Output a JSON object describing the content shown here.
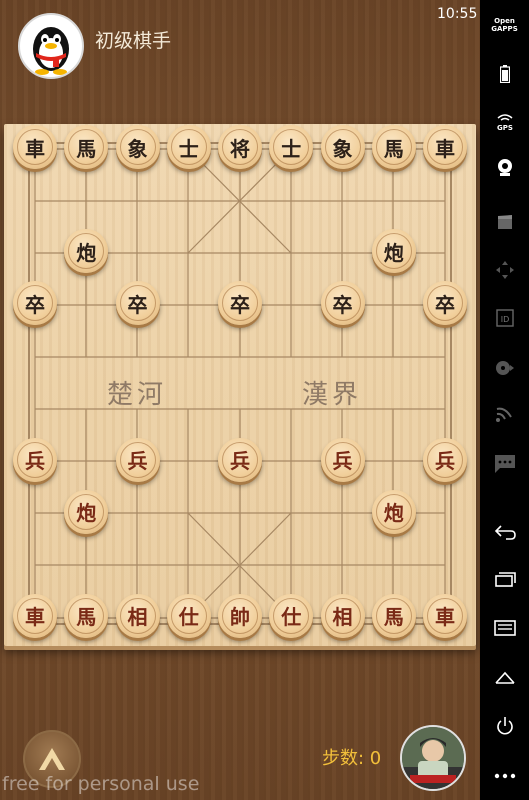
{
  "status": {
    "time": "10:55"
  },
  "header": {
    "title": "初级棋手"
  },
  "board": {
    "river_left": "楚河",
    "river_right": "漢界",
    "black_pieces": [
      {
        "ch": "車",
        "c": 0,
        "r": 0
      },
      {
        "ch": "馬",
        "c": 1,
        "r": 0
      },
      {
        "ch": "象",
        "c": 2,
        "r": 0
      },
      {
        "ch": "士",
        "c": 3,
        "r": 0
      },
      {
        "ch": "将",
        "c": 4,
        "r": 0
      },
      {
        "ch": "士",
        "c": 5,
        "r": 0
      },
      {
        "ch": "象",
        "c": 6,
        "r": 0
      },
      {
        "ch": "馬",
        "c": 7,
        "r": 0
      },
      {
        "ch": "車",
        "c": 8,
        "r": 0
      },
      {
        "ch": "炮",
        "c": 1,
        "r": 2
      },
      {
        "ch": "炮",
        "c": 7,
        "r": 2
      },
      {
        "ch": "卒",
        "c": 0,
        "r": 3
      },
      {
        "ch": "卒",
        "c": 2,
        "r": 3
      },
      {
        "ch": "卒",
        "c": 4,
        "r": 3
      },
      {
        "ch": "卒",
        "c": 6,
        "r": 3
      },
      {
        "ch": "卒",
        "c": 8,
        "r": 3
      }
    ],
    "red_pieces": [
      {
        "ch": "兵",
        "c": 0,
        "r": 6
      },
      {
        "ch": "兵",
        "c": 2,
        "r": 6
      },
      {
        "ch": "兵",
        "c": 4,
        "r": 6
      },
      {
        "ch": "兵",
        "c": 6,
        "r": 6
      },
      {
        "ch": "兵",
        "c": 8,
        "r": 6
      },
      {
        "ch": "炮",
        "c": 1,
        "r": 7
      },
      {
        "ch": "炮",
        "c": 7,
        "r": 7
      },
      {
        "ch": "車",
        "c": 0,
        "r": 9
      },
      {
        "ch": "馬",
        "c": 1,
        "r": 9
      },
      {
        "ch": "相",
        "c": 2,
        "r": 9
      },
      {
        "ch": "仕",
        "c": 3,
        "r": 9
      },
      {
        "ch": "帥",
        "c": 4,
        "r": 9
      },
      {
        "ch": "仕",
        "c": 5,
        "r": 9
      },
      {
        "ch": "相",
        "c": 6,
        "r": 9
      },
      {
        "ch": "馬",
        "c": 7,
        "r": 9
      },
      {
        "ch": "車",
        "c": 8,
        "r": 9
      }
    ]
  },
  "footer": {
    "step_text": "步数: 0",
    "watermark": "free for personal use"
  },
  "sidebar": {
    "items": [
      {
        "label": "Open\nGAPPS",
        "icon": "opengapps-icon"
      },
      {
        "label": "",
        "icon": "battery-icon"
      },
      {
        "label": "GPS",
        "icon": "gps-icon"
      },
      {
        "label": "",
        "icon": "webcam-icon"
      },
      {
        "label": "",
        "icon": "clapper-icon"
      },
      {
        "label": "",
        "icon": "dpad-icon"
      },
      {
        "label": "ID",
        "icon": "id-icon"
      },
      {
        "label": "",
        "icon": "disc-icon"
      },
      {
        "label": "",
        "icon": "cast-icon"
      },
      {
        "label": "",
        "icon": "message-icon"
      },
      {
        "label": "",
        "icon": "back-icon"
      },
      {
        "label": "",
        "icon": "recent-apps-icon"
      },
      {
        "label": "",
        "icon": "menu-icon"
      },
      {
        "label": "",
        "icon": "home-icon"
      },
      {
        "label": "",
        "icon": "power-icon"
      },
      {
        "label": "",
        "icon": "more-icon"
      }
    ]
  },
  "colors": {
    "step": "#f3c03a",
    "red_piece_text": "#7a2a16",
    "black_piece_text": "#2d2119"
  }
}
